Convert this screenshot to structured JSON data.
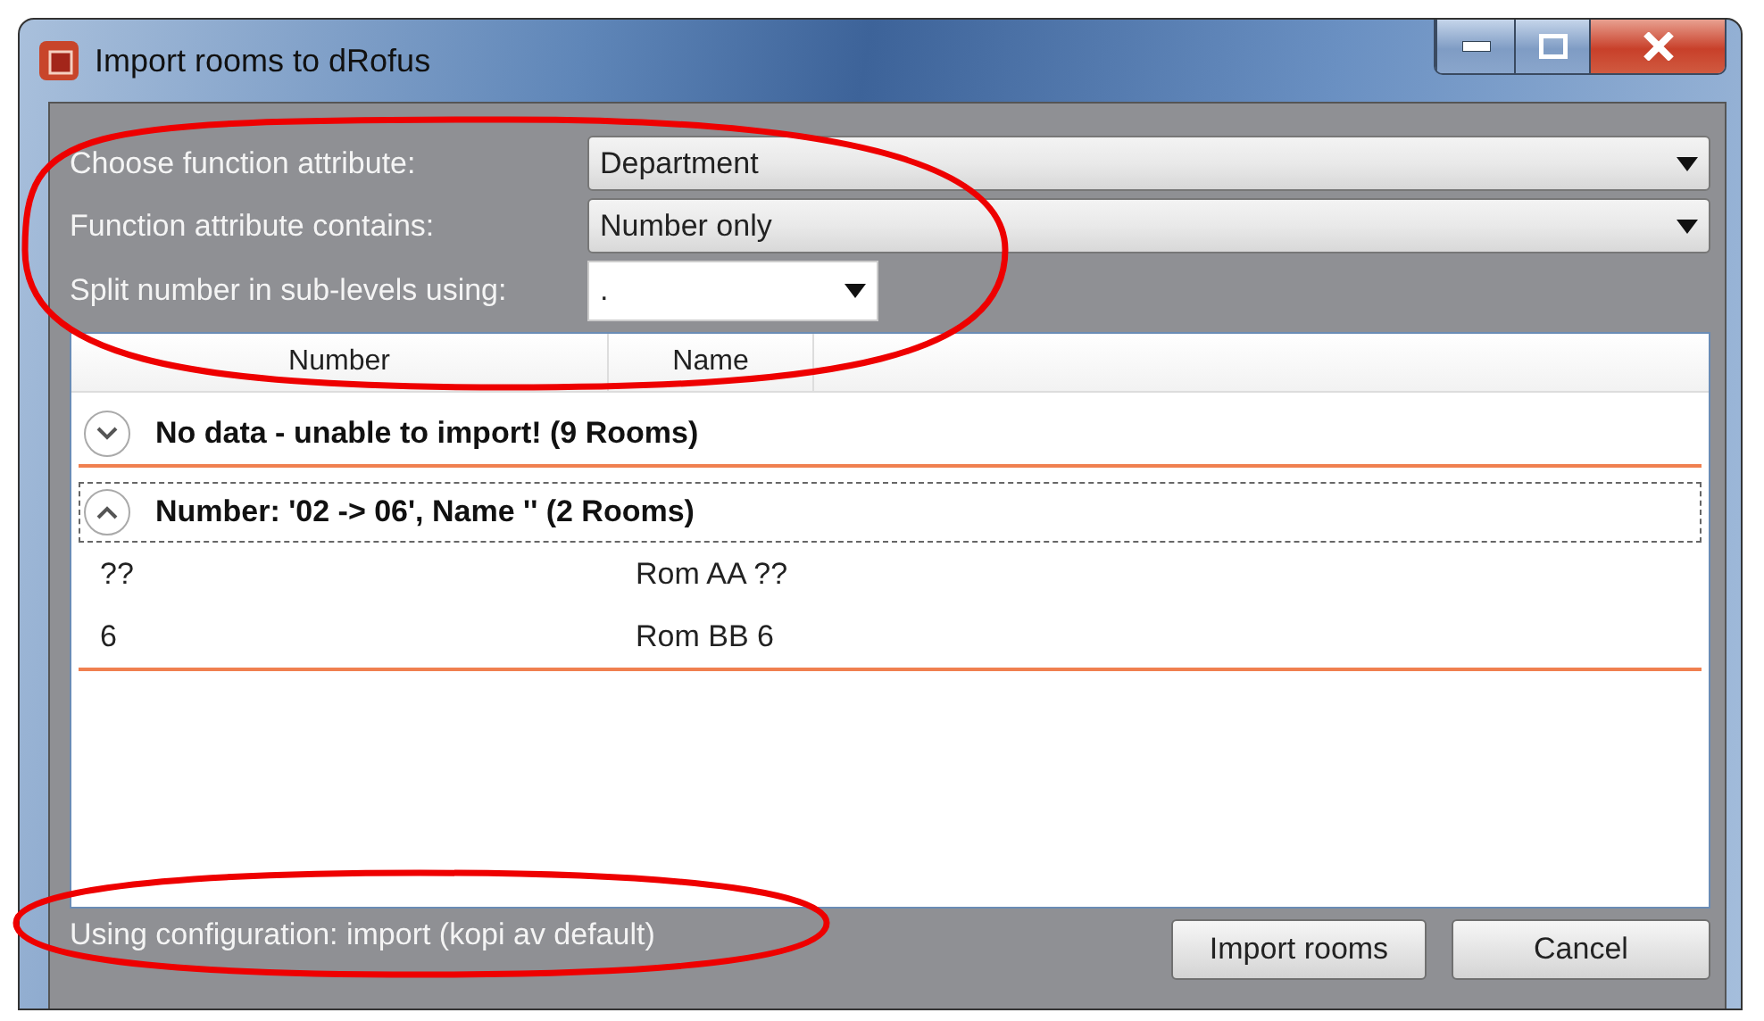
{
  "window": {
    "title": "Import rooms to dRofus"
  },
  "settings": [
    {
      "label": "Choose function attribute:",
      "value": "Department",
      "kind": "dropdown"
    },
    {
      "label": "Function attribute contains:",
      "value": "Number only",
      "kind": "dropdown"
    },
    {
      "label": "Split number in sub-levels using:",
      "value": ".",
      "kind": "editable"
    }
  ],
  "table": {
    "columns": [
      "Number",
      "Name"
    ],
    "groups": [
      {
        "title": "No data - unable to import! (9 Rooms)",
        "expanded": false,
        "focused": false
      },
      {
        "title": "Number: '02 -> 06', Name '' (2 Rooms)",
        "expanded": true,
        "focused": true,
        "rows": [
          [
            "??",
            "Rom AA ??"
          ],
          [
            "6",
            "Rom BB 6"
          ]
        ]
      }
    ]
  },
  "status": "Using configuration: import (kopi av default)",
  "buttons": [
    "Import rooms",
    "Cancel"
  ]
}
